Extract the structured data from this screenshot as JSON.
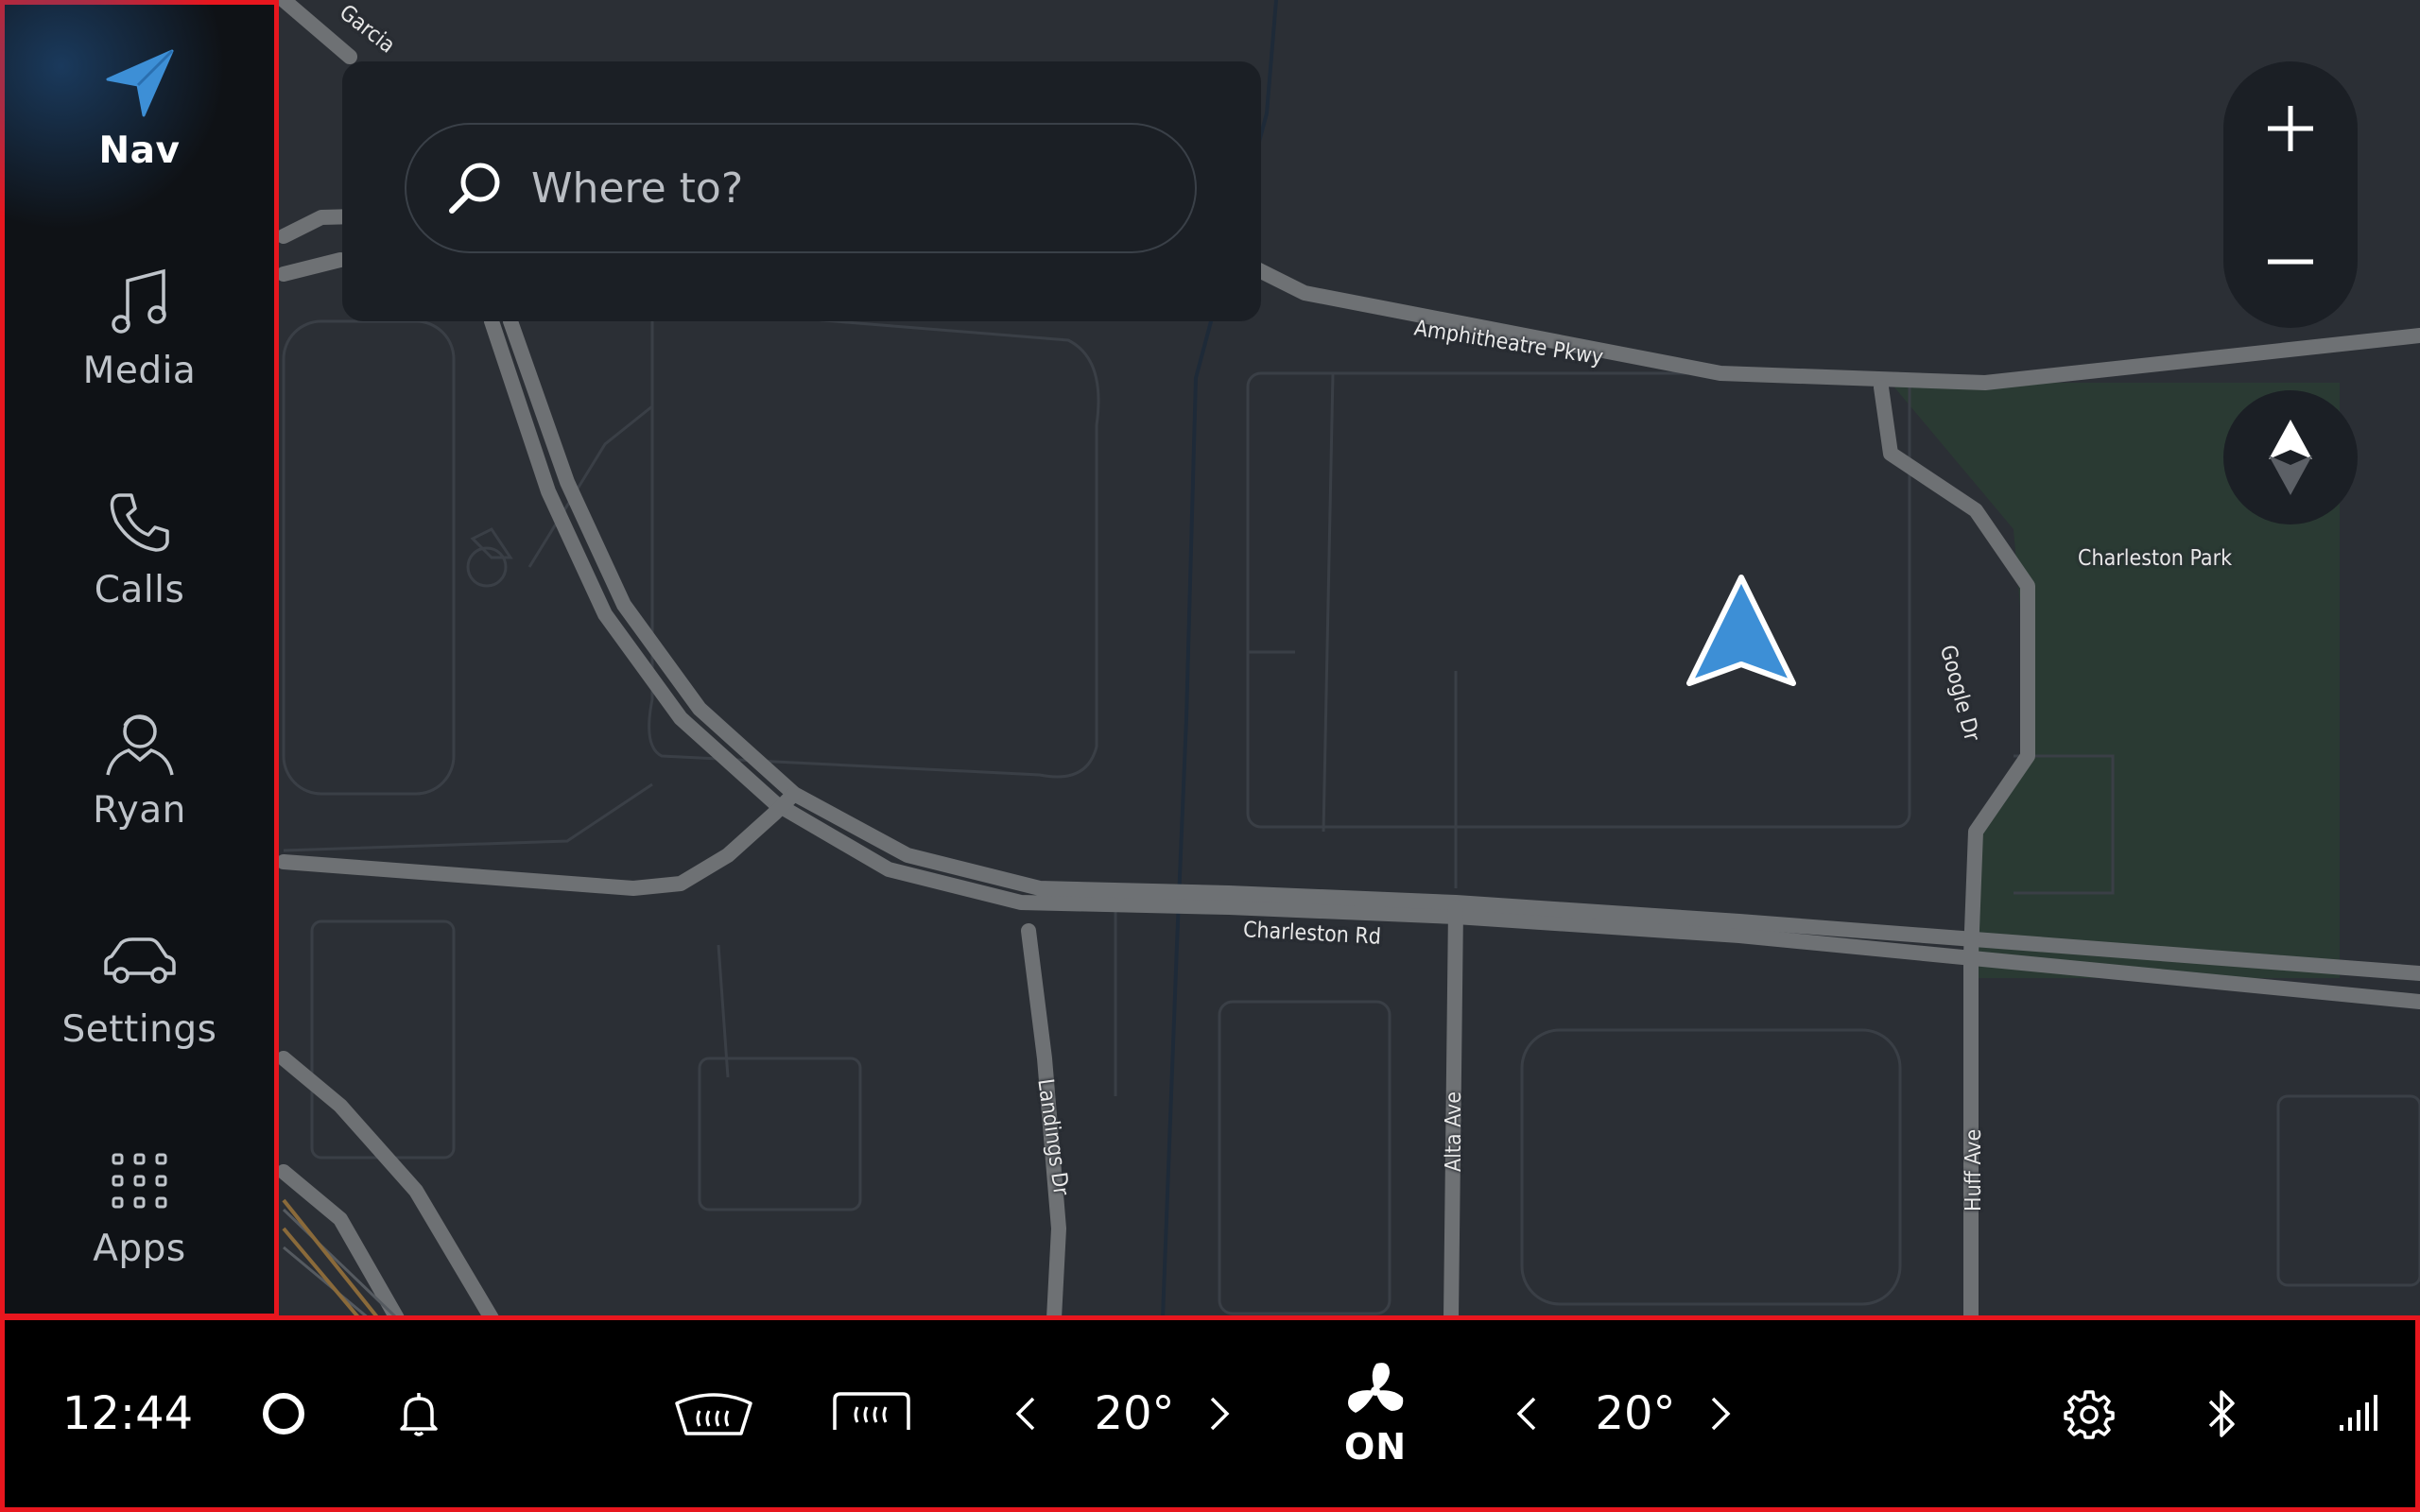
{
  "sidebar": {
    "items": [
      {
        "label": "Nav",
        "icon": "navigation-arrow-icon",
        "active": true
      },
      {
        "label": "Media",
        "icon": "music-note-icon",
        "active": false
      },
      {
        "label": "Calls",
        "icon": "phone-icon",
        "active": false
      },
      {
        "label": "Ryan",
        "icon": "user-profile-icon",
        "active": false
      },
      {
        "label": "Settings",
        "icon": "car-icon",
        "active": false
      },
      {
        "label": "Apps",
        "icon": "app-grid-icon",
        "active": false
      }
    ]
  },
  "search": {
    "placeholder": "Where to?"
  },
  "map": {
    "labels": {
      "garcia": "Garcia",
      "amphitheatre": "Amphitheatre Pkwy",
      "charleston_park": "Charleston Park",
      "google_dr": "Google Dr",
      "charleston_rd": "Charleston Rd",
      "landings_dr": "Landings Dr",
      "alta_ave": "Alta Ave",
      "huff_ave": "Huff Ave"
    },
    "zoom_in": "+",
    "zoom_out": "−",
    "colors": {
      "background": "#2b2f35",
      "road": "#7a7c7e",
      "park": "#2a3a33",
      "position_marker": "#3d8fd6"
    }
  },
  "bottom_bar": {
    "time": "12:44",
    "left_temp": "20°",
    "right_temp": "20°",
    "fan_status": "ON",
    "icons": [
      "home-circle-icon",
      "bell-icon",
      "front-defrost-icon",
      "rear-defrost-icon",
      "chevron-left-icon",
      "chevron-right-icon",
      "fan-icon",
      "gear-icon",
      "bluetooth-icon",
      "signal-icon"
    ]
  },
  "accent": "#e8161e"
}
